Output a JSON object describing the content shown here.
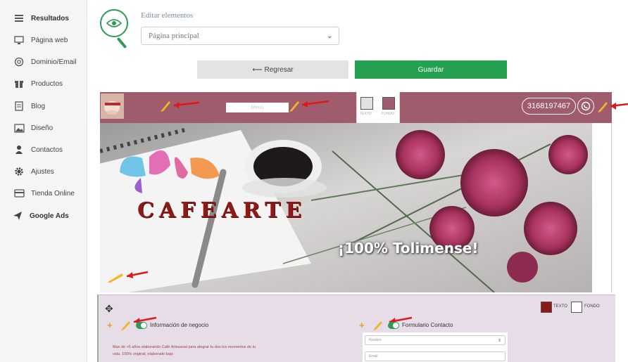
{
  "sidebar": {
    "items": [
      {
        "label": "Resultados",
        "icon": "menu-icon",
        "bold": true
      },
      {
        "label": "Página web",
        "icon": "monitor-icon"
      },
      {
        "label": "Dominio/Email",
        "icon": "at-icon"
      },
      {
        "label": "Productos",
        "icon": "gift-icon"
      },
      {
        "label": "Blog",
        "icon": "document-icon"
      },
      {
        "label": "Diseño",
        "icon": "image-icon"
      },
      {
        "label": "Contactos",
        "icon": "user-icon"
      },
      {
        "label": "Ajustes",
        "icon": "gear-icon"
      },
      {
        "label": "Tienda Online",
        "icon": "card-icon"
      },
      {
        "label": "Google Ads",
        "icon": "send-icon",
        "bold": true
      }
    ]
  },
  "editor": {
    "title": "Editar elementos",
    "page_select": "Página principal"
  },
  "actions": {
    "back_label": "⟵ Regresar",
    "save_label": "Guardar"
  },
  "site": {
    "menu_placeholder": "Menú",
    "swatch_labels": [
      "TEXTO",
      "FONDO"
    ],
    "phone": "3168197467",
    "brand": "CAFEARTE",
    "slogan": "¡100% Tolimense!"
  },
  "section_colors": {
    "text_label": "TEXTO",
    "bg_label": "FONDO"
  },
  "sections": {
    "business_info_label": "Información de negocio",
    "business_description": "Mas de +5 años elaborando Café Artesanal para alegrar tu dos los momentos de tu vida. 100% original, elaborado bajo",
    "contact_form_label": "Formulario Contacto",
    "form_fields": [
      "Nombre",
      "Email"
    ]
  },
  "colors": {
    "brand_green": "#24a050",
    "site_bar": "#9e5c6d",
    "brand_red": "#8e1a17",
    "lower_bg": "#e7dde9",
    "pencil": "#f1b52a",
    "arrow": "#e01818"
  }
}
